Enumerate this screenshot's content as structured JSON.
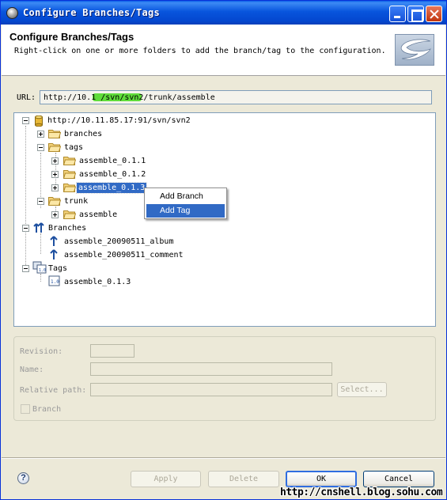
{
  "window": {
    "title": "Configure Branches/Tags"
  },
  "header": {
    "title": "Configure Branches/Tags",
    "description": "Right-click on one or more folders to add the branch/tag to the configuration."
  },
  "url": {
    "label": "URL:",
    "value": "http://10.1           /svn/svn2/trunk/assemble"
  },
  "tree": {
    "root": "http://10.11.85.17:91/svn/svn2",
    "branches_folder": "branches",
    "tags_folder": "tags",
    "tag_items": [
      "assemble_0.1.1",
      "assemble_0.1.2",
      "assemble_0.1.3"
    ],
    "trunk_folder": "trunk",
    "trunk_items": [
      "assemble"
    ],
    "branches_config": "Branches",
    "branch_items": [
      "assemble_20090511_album",
      "assemble_20090511_comment"
    ],
    "tags_config": "Tags",
    "tags_config_items": [
      "assemble_0.1.3"
    ]
  },
  "context_menu": {
    "items": [
      "Add Branch",
      "Add Tag"
    ],
    "highlighted": "Add Tag"
  },
  "options": {
    "revision_label": "Revision:",
    "name_label": "Name:",
    "relative_path_label": "Relative path:",
    "select_button": "Select...",
    "branch_checkbox": "Branch"
  },
  "buttons": {
    "help": "?",
    "apply": "Apply",
    "delete": "Delete",
    "ok": "OK",
    "cancel": "Cancel"
  },
  "watermark": "http://cnshell.blog.sohu.com",
  "colors": {
    "title_bar": "#0855dd",
    "selection": "#316ac5",
    "url_highlight": "#5fdc3a"
  }
}
